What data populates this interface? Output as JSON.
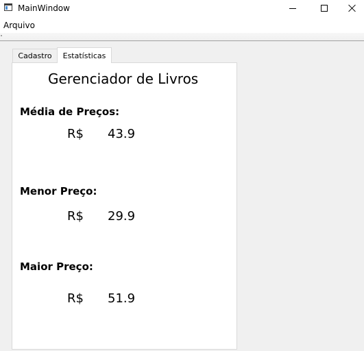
{
  "window": {
    "title": "MainWindow"
  },
  "menu": {
    "items": [
      "Arquivo"
    ]
  },
  "tabs": [
    {
      "label": "Cadastro",
      "active": false
    },
    {
      "label": "Estatísticas",
      "active": true
    }
  ],
  "stats": {
    "heading": "Gerenciador de Livros",
    "average": {
      "label": "Média de Preços:",
      "currency": "R$",
      "value": "43.9"
    },
    "min": {
      "label": "Menor Preço:",
      "currency": "R$",
      "value": "29.9"
    },
    "max": {
      "label": "Maior Preço:",
      "currency": "R$",
      "value": "51.9"
    }
  }
}
